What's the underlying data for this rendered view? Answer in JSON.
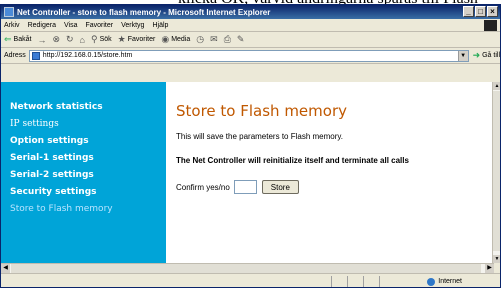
{
  "document": {
    "cropped_text": "klicka OK, varvid ändringarna sparas till Flash"
  },
  "window": {
    "title": "Net Controller - store to flash memory - Microsoft Internet Explorer",
    "controls": [
      "_",
      "□",
      "×"
    ]
  },
  "menu": [
    "Arkiv",
    "Redigera",
    "Visa",
    "Favoriter",
    "Verktyg",
    "Hjälp"
  ],
  "toolbar": {
    "back": "Bakåt",
    "search": "Sök",
    "favorites": "Favoriter",
    "media": "Media"
  },
  "address": {
    "label": "Adress",
    "url": "http://192.168.0.15/store.htm",
    "go": "Gå till"
  },
  "sidebar": {
    "items": [
      "Network statistics",
      "IP settings",
      "Option settings",
      "Serial-1 settings",
      "Serial-2 settings",
      "Security settings",
      "Store to Flash memory"
    ]
  },
  "main": {
    "heading": "Store to Flash memory",
    "info": "This will save the parameters to Flash memory.",
    "warning": "The Net Controller will reinitialize itself and terminate all calls",
    "confirm_label": "Confirm yes/no",
    "confirm_value": "",
    "store_button": "Store"
  },
  "status": {
    "zone": "Internet"
  },
  "colors": {
    "sidebar_bg": "#00a4d8",
    "heading": "#c05800"
  }
}
